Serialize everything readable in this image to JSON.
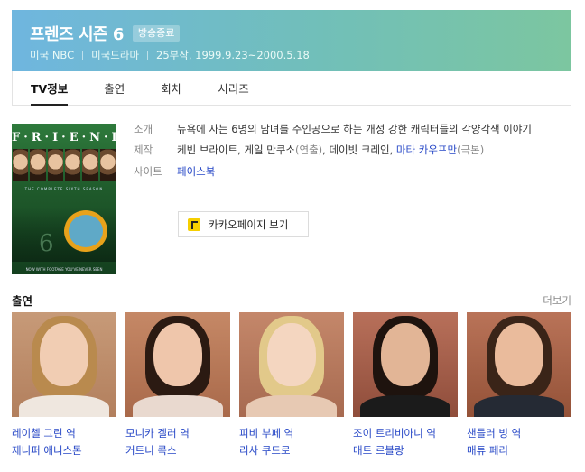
{
  "header": {
    "title": "프렌즈 시즌 6",
    "status_badge": "방송종료",
    "meta": [
      "미국 NBC",
      "미국드라마",
      "25부작, 1999.9.23~2000.5.18"
    ]
  },
  "tabs": [
    {
      "label": "TV정보",
      "active": true
    },
    {
      "label": "출연",
      "active": false
    },
    {
      "label": "회차",
      "active": false
    },
    {
      "label": "시리즈",
      "active": false
    }
  ],
  "poster": {
    "logo": "F·R·I·E·N·D·S",
    "subtitle": "THE COMPLETE SIXTH SEASON",
    "number": "6",
    "footer": "NOW WITH FOOTAGE YOU'VE NEVER SEEN"
  },
  "info": {
    "intro_label": "소개",
    "intro_text": "뉴욕에 사는 6명의 남녀를 주인공으로 하는 개성 강한 캐릭터들의 각양각색 이야기",
    "production_label": "제작",
    "production_part1": "케빈 브라이트, 게일 만쿠소",
    "production_role1": "(연출)",
    "production_part2": ", 데이빗 크레인, ",
    "production_link": "마타 카우프만",
    "production_role2": "(극본)",
    "site_label": "사이트",
    "site_link": "페이스북"
  },
  "kakao_button": {
    "label": "카카오페이지 보기"
  },
  "cast_section": {
    "title": "출연",
    "more_label": "더보기"
  },
  "cast": [
    {
      "role": "레이첼 그린 역",
      "actor": "제니퍼 애니스톤"
    },
    {
      "role": "모니카 겔러 역",
      "actor": "커트니 콕스"
    },
    {
      "role": "피비 부페 역",
      "actor": "리사 쿠드로"
    },
    {
      "role": "조이 트리비아니 역",
      "actor": "매트 르블랑"
    },
    {
      "role": "챈들러 빙 역",
      "actor": "매튜 페리"
    }
  ],
  "colors": {
    "header_gradient_start": "#6fb6df",
    "header_gradient_end": "#7cc6a0",
    "link": "#2546c6"
  }
}
